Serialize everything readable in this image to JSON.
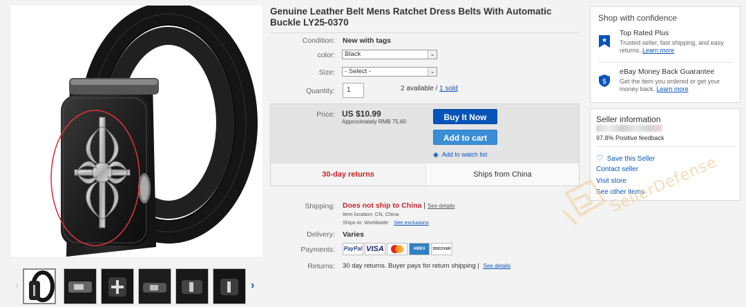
{
  "listing": {
    "title": "Genuine Leather Belt Mens Ratchet Dress Belts With Automatic Buckle LY25-0370"
  },
  "details": {
    "condition_label": "Condition:",
    "condition_value": "New with tags",
    "color_label": "color:",
    "color_value": "Black",
    "size_label": "Size:",
    "size_value": "- Select -",
    "quantity_label": "Quantity:",
    "quantity_value": "1",
    "available": "2 available /",
    "sold": "1 sold"
  },
  "purchase": {
    "price_label": "Price:",
    "price": "US $10.99",
    "approx": "Approximately RMB 75.60",
    "buy_now": "Buy It Now",
    "add_to_cart": "Add to cart",
    "watch": "Add to watch list",
    "returns": "30-day returns",
    "ships_from": "Ships from China"
  },
  "shipping": {
    "shipping_label": "Shipping:",
    "shipping_value": "Does not ship to China",
    "see_details": "See details",
    "item_location": "Item location:  CN, China",
    "ships_to": "Ships to:  Worldwide",
    "see_exclusions": "See exclusions",
    "delivery_label": "Delivery:",
    "delivery_value": "Varies",
    "payments_label": "Payments:",
    "returns_label": "Returns:",
    "returns_value": "30 day returns. Buyer pays for return shipping |",
    "returns_link": "See details"
  },
  "payment_logos": [
    "PayPal",
    "VISA",
    "MasterCard",
    "AMEX",
    "DISCOVER"
  ],
  "confidence": {
    "title": "Shop with confidence",
    "items": [
      {
        "heading": "Top Rated Plus",
        "text": "Trusted seller, fast shipping, and easy returns.",
        "link": "Learn more",
        "icon": "top-rated-badge-icon"
      },
      {
        "heading": "eBay Money Back Guarantee",
        "text": "Get the item you ordered or get your money back.",
        "link": "Learn more",
        "icon": "money-back-shield-icon"
      }
    ]
  },
  "seller": {
    "title": "Seller information",
    "feedback": "97.8% Positive feedback",
    "save": "Save this Seller",
    "contact": "Contact seller",
    "visit": "Visit store",
    "other": "See other items"
  },
  "watermark": "SellerDefense",
  "colors": {
    "link": "#0654ba",
    "buy_button": "#0654ba",
    "cart_button": "#3a8ed6",
    "alert_red": "#c4242b"
  }
}
